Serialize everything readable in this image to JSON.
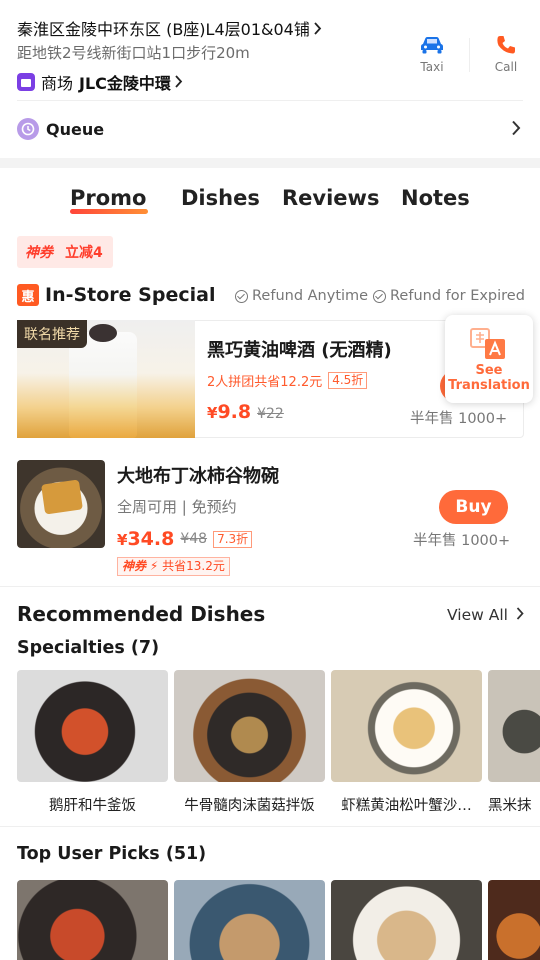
{
  "store": {
    "address": "秦淮区金陵中环东区 (B座)L4层01&04铺",
    "metro_distance": "距地铁2号线新街口站1口步行20m",
    "mall_label": "商场",
    "mall_name": "JLC金陵中環"
  },
  "actions": [
    {
      "label": "Taxi",
      "icon": "car-icon",
      "color": "#1a73e8"
    },
    {
      "label": "Call",
      "icon": "phone-icon",
      "color": "#ff5a22"
    }
  ],
  "queue": {
    "label": "Queue"
  },
  "tabs": [
    {
      "label": "Promo",
      "active": true
    },
    {
      "label": "Dishes",
      "active": false
    },
    {
      "label": "Reviews",
      "active": false
    },
    {
      "label": "Notes",
      "active": false
    }
  ],
  "coupon": {
    "brand": "神券",
    "text": "立减4"
  },
  "in_store": {
    "badge": "惠",
    "title": "In-Store Special",
    "guarantee_1": "Refund Anytime",
    "guarantee_2": "Refund for Expired"
  },
  "deals": [
    {
      "tag": "联名推荐",
      "title": "黑巧黄油啤酒 (无酒精)",
      "group_text": "2人拼团共省12.2元",
      "discount": "4.5折",
      "currency": "¥",
      "price": "9.8",
      "original_price": "¥22",
      "sold": "半年售 1000+"
    },
    {
      "title": "大地布丁冰柿谷物碗",
      "subtitle": "全周可用 | 免预约",
      "currency": "¥",
      "price": "34.8",
      "original_price": "¥48",
      "discount": "7.3折",
      "coupon_brand": "神券",
      "coupon_save": "共省13.2元",
      "buy_label": "Buy",
      "sold": "半年售 1000+"
    }
  ],
  "translation": {
    "line1": "See",
    "line2": "Translation"
  },
  "recommended": {
    "title": "Recommended Dishes",
    "view_all": "View All",
    "specialties_title": "Specialties (7)",
    "dishes": [
      "鹅肝和牛釜饭",
      "牛骨髓肉沫菌菇拌饭",
      "虾糕黄油松叶蟹沙…",
      "黑米抹"
    ]
  },
  "top_picks": {
    "title": "Top User Picks (51)"
  },
  "colors": {
    "accent": "#ff6a3a",
    "price": "#ff4a24",
    "taxi": "#1a73e8",
    "call": "#ff5a22"
  }
}
